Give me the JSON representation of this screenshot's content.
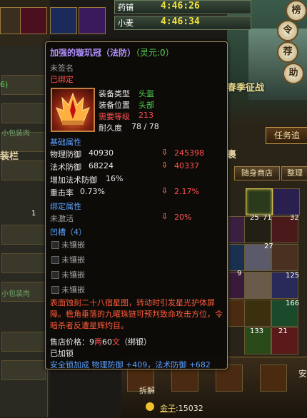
{
  "background": {
    "timers": [
      {
        "label": "药铺",
        "value": "4:46:26"
      },
      {
        "label": "小麦",
        "value": "4:46:34"
      }
    ],
    "side_buttons": [
      "榜",
      "令",
      "荐",
      "助"
    ],
    "event_label": "春季征战",
    "task_tab": "任务追",
    "bag_title": "裹",
    "bag_tabs": [
      "随身商店",
      "整理"
    ],
    "counts": [
      "25",
      "71",
      "32",
      "27",
      "9",
      "125",
      "166",
      "133",
      "21"
    ],
    "left_texts": [
      "小包装肉",
      "小包装肉",
      "6)",
      "1"
    ],
    "left_section": "装栏",
    "bottom_button": "拆解",
    "gold": {
      "key": "金子",
      "value": ":15032"
    },
    "right_partial": "安"
  },
  "tooltip": {
    "name": "加强的璇玑冠（法防）",
    "spirit": "（灵元:0）",
    "unsigned": "未签名",
    "bound": "已绑定",
    "info": [
      {
        "label": "装备类型",
        "value": "头盔"
      },
      {
        "label": "装备位置",
        "value": "头部"
      },
      {
        "label": "需要等级",
        "value": "213"
      },
      {
        "label": "耐久度",
        "value": "78 / 78"
      }
    ],
    "base_header": "基础属性",
    "base_attrs": [
      {
        "label": "物理防御",
        "value": "40930",
        "compare": "245398"
      },
      {
        "label": "法术防御",
        "value": "68224",
        "compare": "40337"
      },
      {
        "label": "增加法术防御",
        "value": "16%",
        "compare": ""
      },
      {
        "label": "重击率",
        "value": "0.73%",
        "compare": "2.17%"
      }
    ],
    "bind_header": "绑定属性",
    "bind_state": "未激活",
    "bind_compare": "20%",
    "socket_header": "凹槽（4）",
    "sockets": [
      "未镶嵌",
      "未镶嵌",
      "未镶嵌",
      "未镶嵌"
    ],
    "description": "表面蚀刻二十八宿星图，转动时引发星光护体屏障。檐角垂落的九曜珠链可预判致命攻击方位，令暗杀者反遭星辉灼目。",
    "price_label": "售店价格：",
    "price": [
      {
        "amount": "9",
        "unit": "两"
      },
      {
        "amount": "60",
        "unit": "文"
      }
    ],
    "price_note": "（绑银）",
    "locked": "已加锁",
    "security_bonus": "安全锁加成  物理防御 +409，法术防御 +682"
  }
}
